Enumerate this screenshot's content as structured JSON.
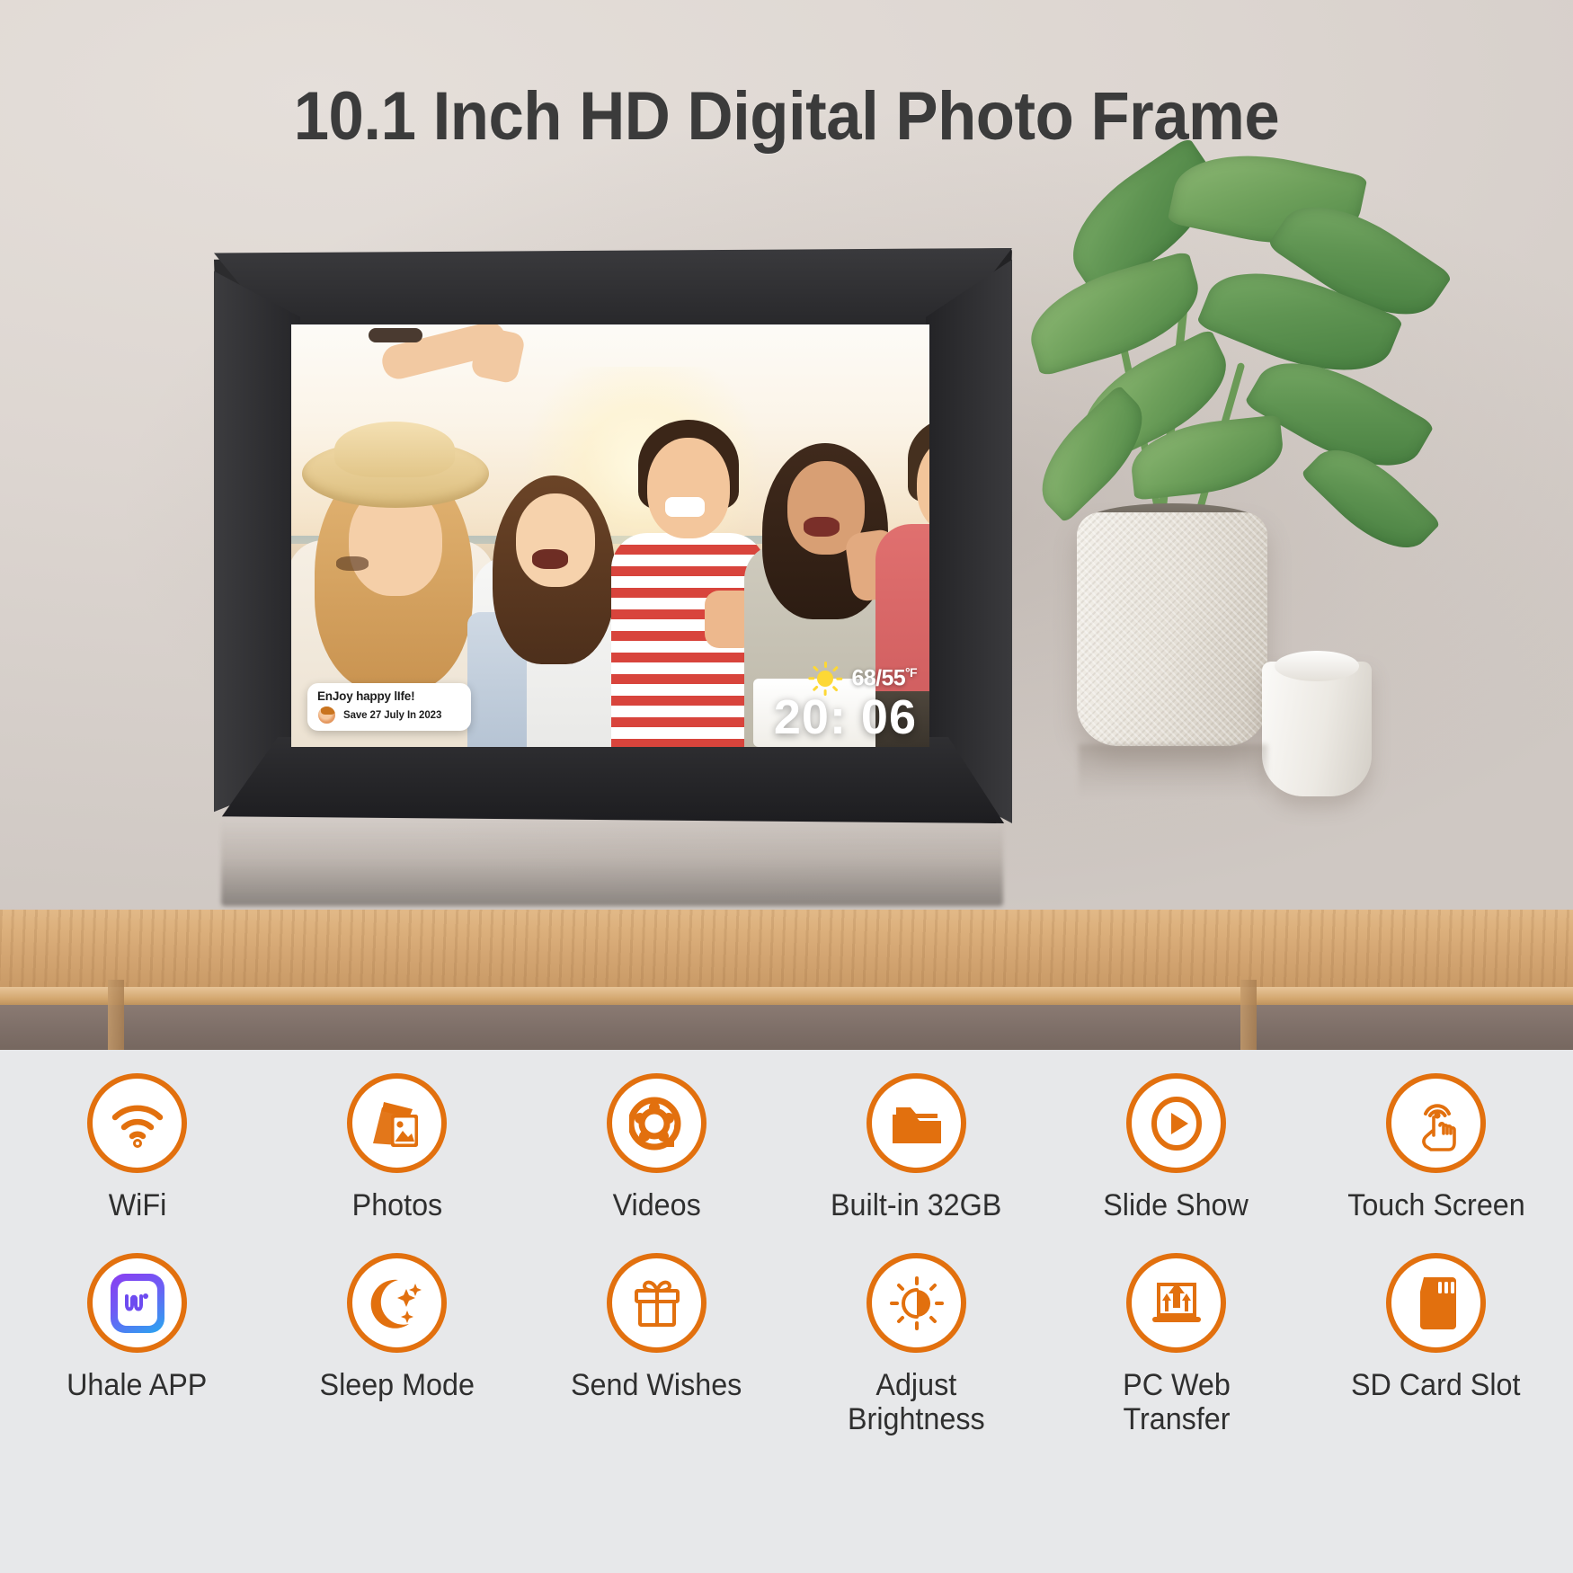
{
  "hero": {
    "title": "10.1 Inch HD Digital Photo Frame"
  },
  "device": {
    "screen": {
      "message_bubble": {
        "title": "EnJoy happy lIfe!",
        "subtitle": "Save 27 July In 2023",
        "avatar_icon": "user-avatar-icon"
      },
      "weather": {
        "icon": "sun-icon",
        "temperature": "68/55",
        "unit": "°F"
      },
      "clock": "20: 06"
    }
  },
  "features": {
    "row1": [
      {
        "icon": "wifi-icon",
        "label": "WiFi"
      },
      {
        "icon": "photos-icon",
        "label": "Photos"
      },
      {
        "icon": "film-reel-icon",
        "label": "Videos"
      },
      {
        "icon": "folder-icon",
        "label": "Built-in 32GB"
      },
      {
        "icon": "play-circle-icon",
        "label": "Slide Show"
      },
      {
        "icon": "touch-hand-icon",
        "label": "Touch Screen"
      }
    ],
    "row2": [
      {
        "icon": "uhale-app-icon",
        "label": "Uhale APP"
      },
      {
        "icon": "moon-sparkle-icon",
        "label": "Sleep Mode"
      },
      {
        "icon": "gift-box-icon",
        "label": "Send Wishes"
      },
      {
        "icon": "brightness-icon",
        "label": "Adjust\nBrightness"
      },
      {
        "icon": "laptop-upload-icon",
        "label": "PC Web\nTransfer"
      },
      {
        "icon": "sd-card-icon",
        "label": "SD Card Slot"
      }
    ]
  },
  "colors": {
    "accent_orange": "#e2700e",
    "panel_background": "#e7e8ea",
    "title_text": "#3b3b3b",
    "frame_black": "#232325",
    "uhale_purple": "#6d4bf0"
  }
}
